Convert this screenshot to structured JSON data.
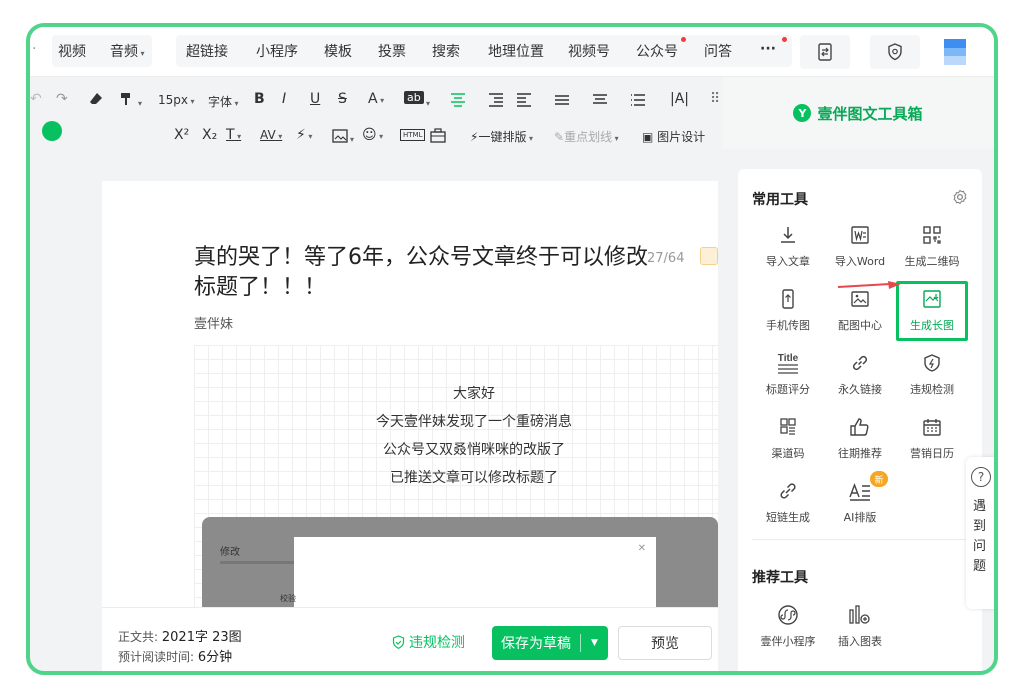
{
  "topbar": {
    "items": [
      "视频",
      "音频",
      "超链接",
      "小程序",
      "模板",
      "投票",
      "搜索",
      "地理位置",
      "视频号",
      "公众号",
      "问答"
    ],
    "more": "···"
  },
  "format1": {
    "font_size": "15px",
    "font_family": "字体",
    "bold": "B",
    "italic": "I",
    "underline": "U",
    "strike": "S",
    "font_color": "A",
    "bg_color": "ab",
    "letter_spacing": "|A|"
  },
  "format2": {
    "superscript": "X²",
    "subscript": "X₂",
    "first_indent": "T",
    "spacing": "AV",
    "one_click_layout": "一键排版",
    "highlight": "重点划线",
    "image_design": "图片设计",
    "html_label": "HTML"
  },
  "editor": {
    "title": "真的哭了！等了6年，公众号文章终于可以修改标题了！！！",
    "title_count": "27/64",
    "author": "壹伴妹",
    "body": [
      "大家好",
      "今天壹伴妹发现了一个重磅消息",
      "公众号又双叒悄咪咪的改版了",
      "已推送文章可以修改标题了"
    ],
    "embedded_title": "修改",
    "embedded_foot": "校验"
  },
  "bottom": {
    "word_label": "正文共:",
    "word_value": "2021字 23图",
    "time_label": "预计阅读时间:",
    "time_value": "6分钟",
    "check": "违规检测",
    "save": "保存为草稿",
    "preview": "预览"
  },
  "panel": {
    "brand": "壹伴图文工具箱",
    "common_title": "常用工具",
    "tools": [
      {
        "label": "导入文章",
        "icon": "import-icon"
      },
      {
        "label": "导入Word",
        "icon": "word-icon"
      },
      {
        "label": "生成二维码",
        "icon": "qrcode-icon"
      },
      {
        "label": "手机传图",
        "icon": "phone-upload-icon"
      },
      {
        "label": "配图中心",
        "icon": "image-center-icon"
      },
      {
        "label": "生成长图",
        "icon": "long-image-icon"
      },
      {
        "label": "标题评分",
        "icon": "title-score-icon"
      },
      {
        "label": "永久链接",
        "icon": "link-icon"
      },
      {
        "label": "违规检测",
        "icon": "shield-icon"
      },
      {
        "label": "渠道码",
        "icon": "channel-code-icon"
      },
      {
        "label": "往期推荐",
        "icon": "thumbs-up-icon"
      },
      {
        "label": "营销日历",
        "icon": "calendar-icon"
      },
      {
        "label": "短链生成",
        "icon": "short-link-icon"
      },
      {
        "label": "AI排版",
        "icon": "ai-layout-icon"
      }
    ],
    "new_badge": "新",
    "title_icon_text": "Title",
    "recommend_title": "推荐工具",
    "recommend": [
      {
        "label": "壹伴小程序",
        "icon": "mini-program-icon"
      },
      {
        "label": "插入图表",
        "icon": "chart-icon"
      }
    ]
  },
  "help": {
    "icon": "?",
    "text": "遇到问题"
  },
  "colors": {
    "brand_green": "#07c160",
    "frame_green": "#4fd48a",
    "arrow_red": "#e8474b"
  }
}
